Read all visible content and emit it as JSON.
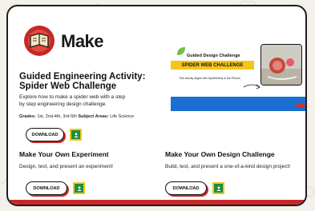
{
  "header": {
    "title": "Make"
  },
  "activity": {
    "title": "Guided Engineering Activity: Spider Web Challenge",
    "description": "Explore how to make a spider web with a step by step engineering design challenge.",
    "grades_label": "Grades:",
    "grades_value": "1st, 2nd-4th, 3rd-5th",
    "subject_label": "Subject Areas:",
    "subject_value": "Life Science",
    "download_label": "DOWNLOAD"
  },
  "banner": {
    "title": "Guided Design Challenge",
    "tag": "SPIDER WEB CHALLENGE",
    "subtitle": "This activity aligns with SpideWhirly in the Person"
  },
  "experiment": {
    "title": "Make Your Own Experiment",
    "description": "Design, test, and present an experiment!",
    "download_label": "DOWNLOAD"
  },
  "design": {
    "title": "Make Your Own Design Challenge",
    "description": "Build, test, and present a one-of-a-kind design project!",
    "download_label": "DOWNLOAD"
  },
  "colors": {
    "accent_red": "#c62828",
    "classroom_green": "#1e8e3e",
    "classroom_yellow": "#f5c518",
    "banner_blue": "#1b6fd0"
  }
}
